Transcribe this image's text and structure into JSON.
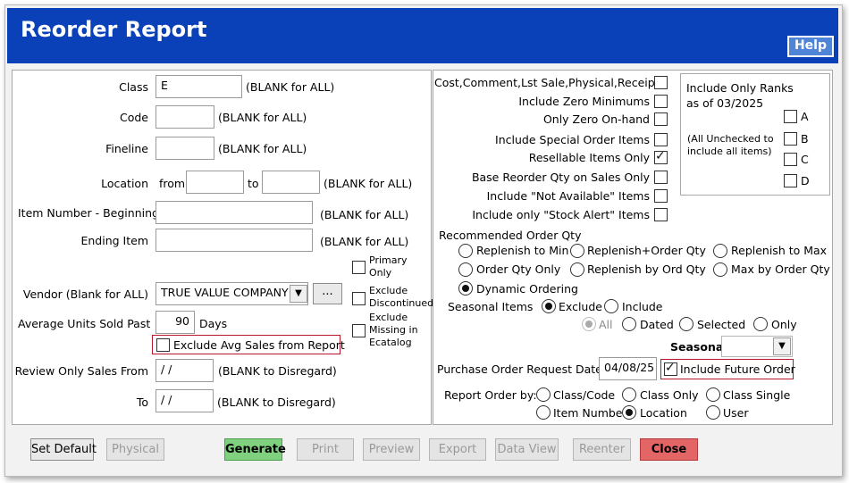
{
  "window": {
    "title": "Reorder Report",
    "help": "Help"
  },
  "left": {
    "class_label": "Class",
    "class_value": "E",
    "class_hint": "(BLANK for ALL)",
    "code_label": "Code",
    "code_value": "",
    "code_hint": "(BLANK for ALL)",
    "fineline_label": "Fineline",
    "fineline_value": "",
    "fineline_hint": "(BLANK for ALL)",
    "location_label": "Location",
    "location_from": "from",
    "location_to": "to",
    "location_from_value": "",
    "location_to_value": "",
    "location_hint": "(BLANK for ALL)",
    "item_begin_label": "Item Number - Beginning",
    "item_begin_value": "",
    "item_begin_hint": "(BLANK for ALL)",
    "item_end_label": "Ending Item",
    "item_end_value": "",
    "item_end_hint": "(BLANK for ALL)",
    "primary_only": "Primary\nOnly",
    "exclude_discontinued": "Exclude\nDiscontinued",
    "exclude_missing": "Exclude\nMissing in\nEcatalog",
    "vendor_label": "Vendor (Blank for ALL)",
    "vendor_value": "TRUE VALUE COMPANY",
    "vendor_browse": "...",
    "avg_units_label": "Average Units Sold Past",
    "avg_units_value": "90",
    "avg_units_unit": "Days",
    "exclude_avg_sales": "Exclude Avg Sales from Report",
    "review_from_label": "Review Only Sales From",
    "review_from_value": "/ /",
    "review_from_hint": "(BLANK to Disregard)",
    "review_to_label": "To",
    "review_to_value": "/ /",
    "review_to_hint": "(BLANK to Disregard)"
  },
  "right": {
    "checks": [
      "Cost,Comment,Lst Sale,Physical,Receipt",
      "Include Zero Minimums",
      "Only Zero On-hand",
      "Include Special  Order Items",
      "Resellable Items Only",
      "Base Reorder Qty on Sales Only",
      "Include \"Not Available\" Items",
      "Include only \"Stock Alert\" Items"
    ],
    "ranks_title": "Include Only Ranks\nas of 03/2025",
    "ranks_note": "(All Unchecked to\ninclude all items)",
    "ranks": [
      "A",
      "B",
      "C",
      "D"
    ],
    "rec_title": "Recommended Order Qty",
    "rec_options": [
      "Replenish to Min",
      "Replenish+Order Qty",
      "Replenish to Max",
      "Order Qty Only",
      "Replenish by Ord Qty",
      "Max by Order Qty",
      "Dynamic Ordering"
    ],
    "seasonal_items_label": "Seasonal Items",
    "seasonal_items_opts": [
      "Exclude",
      "Include"
    ],
    "seasonal_sub_opts": [
      "All",
      "Dated",
      "Selected",
      "Only"
    ],
    "seasonal_label": "Seasonal",
    "seasonal_value": "",
    "po_date_label": "Purchase Order Request Date",
    "po_date_value": "04/08/25",
    "include_future": "Include Future Order",
    "report_order_label": "Report Order by:",
    "report_order_opts": [
      "Class/Code",
      "Class Only",
      "Class Single",
      "Item Number",
      "Location",
      "User"
    ]
  },
  "buttons": {
    "set_default": "Set Default",
    "physical": "Physical",
    "generate": "Generate",
    "print": "Print",
    "preview": "Preview",
    "export": "Export",
    "data_view": "Data View",
    "reenter": "Reenter",
    "close": "Close"
  },
  "colors": {
    "title_bar": "#0a40b8",
    "generate": "#7fd17f",
    "close": "#e36565",
    "highlight": "#b8182a"
  }
}
